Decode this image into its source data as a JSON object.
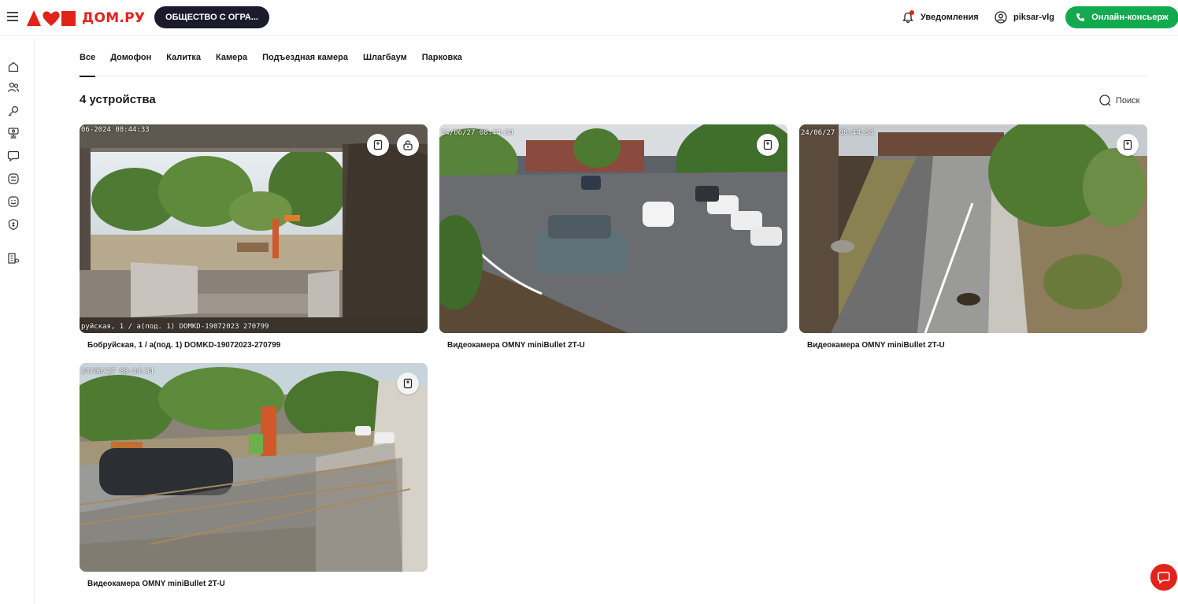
{
  "header": {
    "logo_text": "ДОМ.РУ",
    "org_button": "ОБЩЕСТВО С ОГРА...",
    "notifications": "Уведомления",
    "username": "piksar-vlg",
    "concierge_button": "Онлайн-консьерж"
  },
  "tabs": [
    "Все",
    "Домофон",
    "Калитка",
    "Камера",
    "Подъездная камера",
    "Шлагбаум",
    "Парковка"
  ],
  "active_tab": "Все",
  "devices_count": "4 устройства",
  "search_label": "Поиск",
  "cameras": [
    {
      "title": "Бобруйская, 1 / а(под. 1) DOMKD-19072023-270799",
      "timestamp_top": "06-2024 08:44:33",
      "timestamp_bottom": "руйская, 1 / а(под. 1) DOMKD-19072023 270799"
    },
    {
      "title": "Видеокамера OMNY miniBullet 2T-U",
      "timestamp_top": "24/06/27 08:44:34"
    },
    {
      "title": "Видеокамера OMNY miniBullet 2T-U",
      "timestamp_top": "24/06/27 08:44:34"
    },
    {
      "title": "Видеокамера OMNY miniBullet 2T-U",
      "timestamp_top": "24/06/27 08:44:34"
    }
  ],
  "colors": {
    "brand_red": "#e2231a",
    "concierge_green": "#13a94f",
    "org_button_bg": "#1b1b2b"
  }
}
